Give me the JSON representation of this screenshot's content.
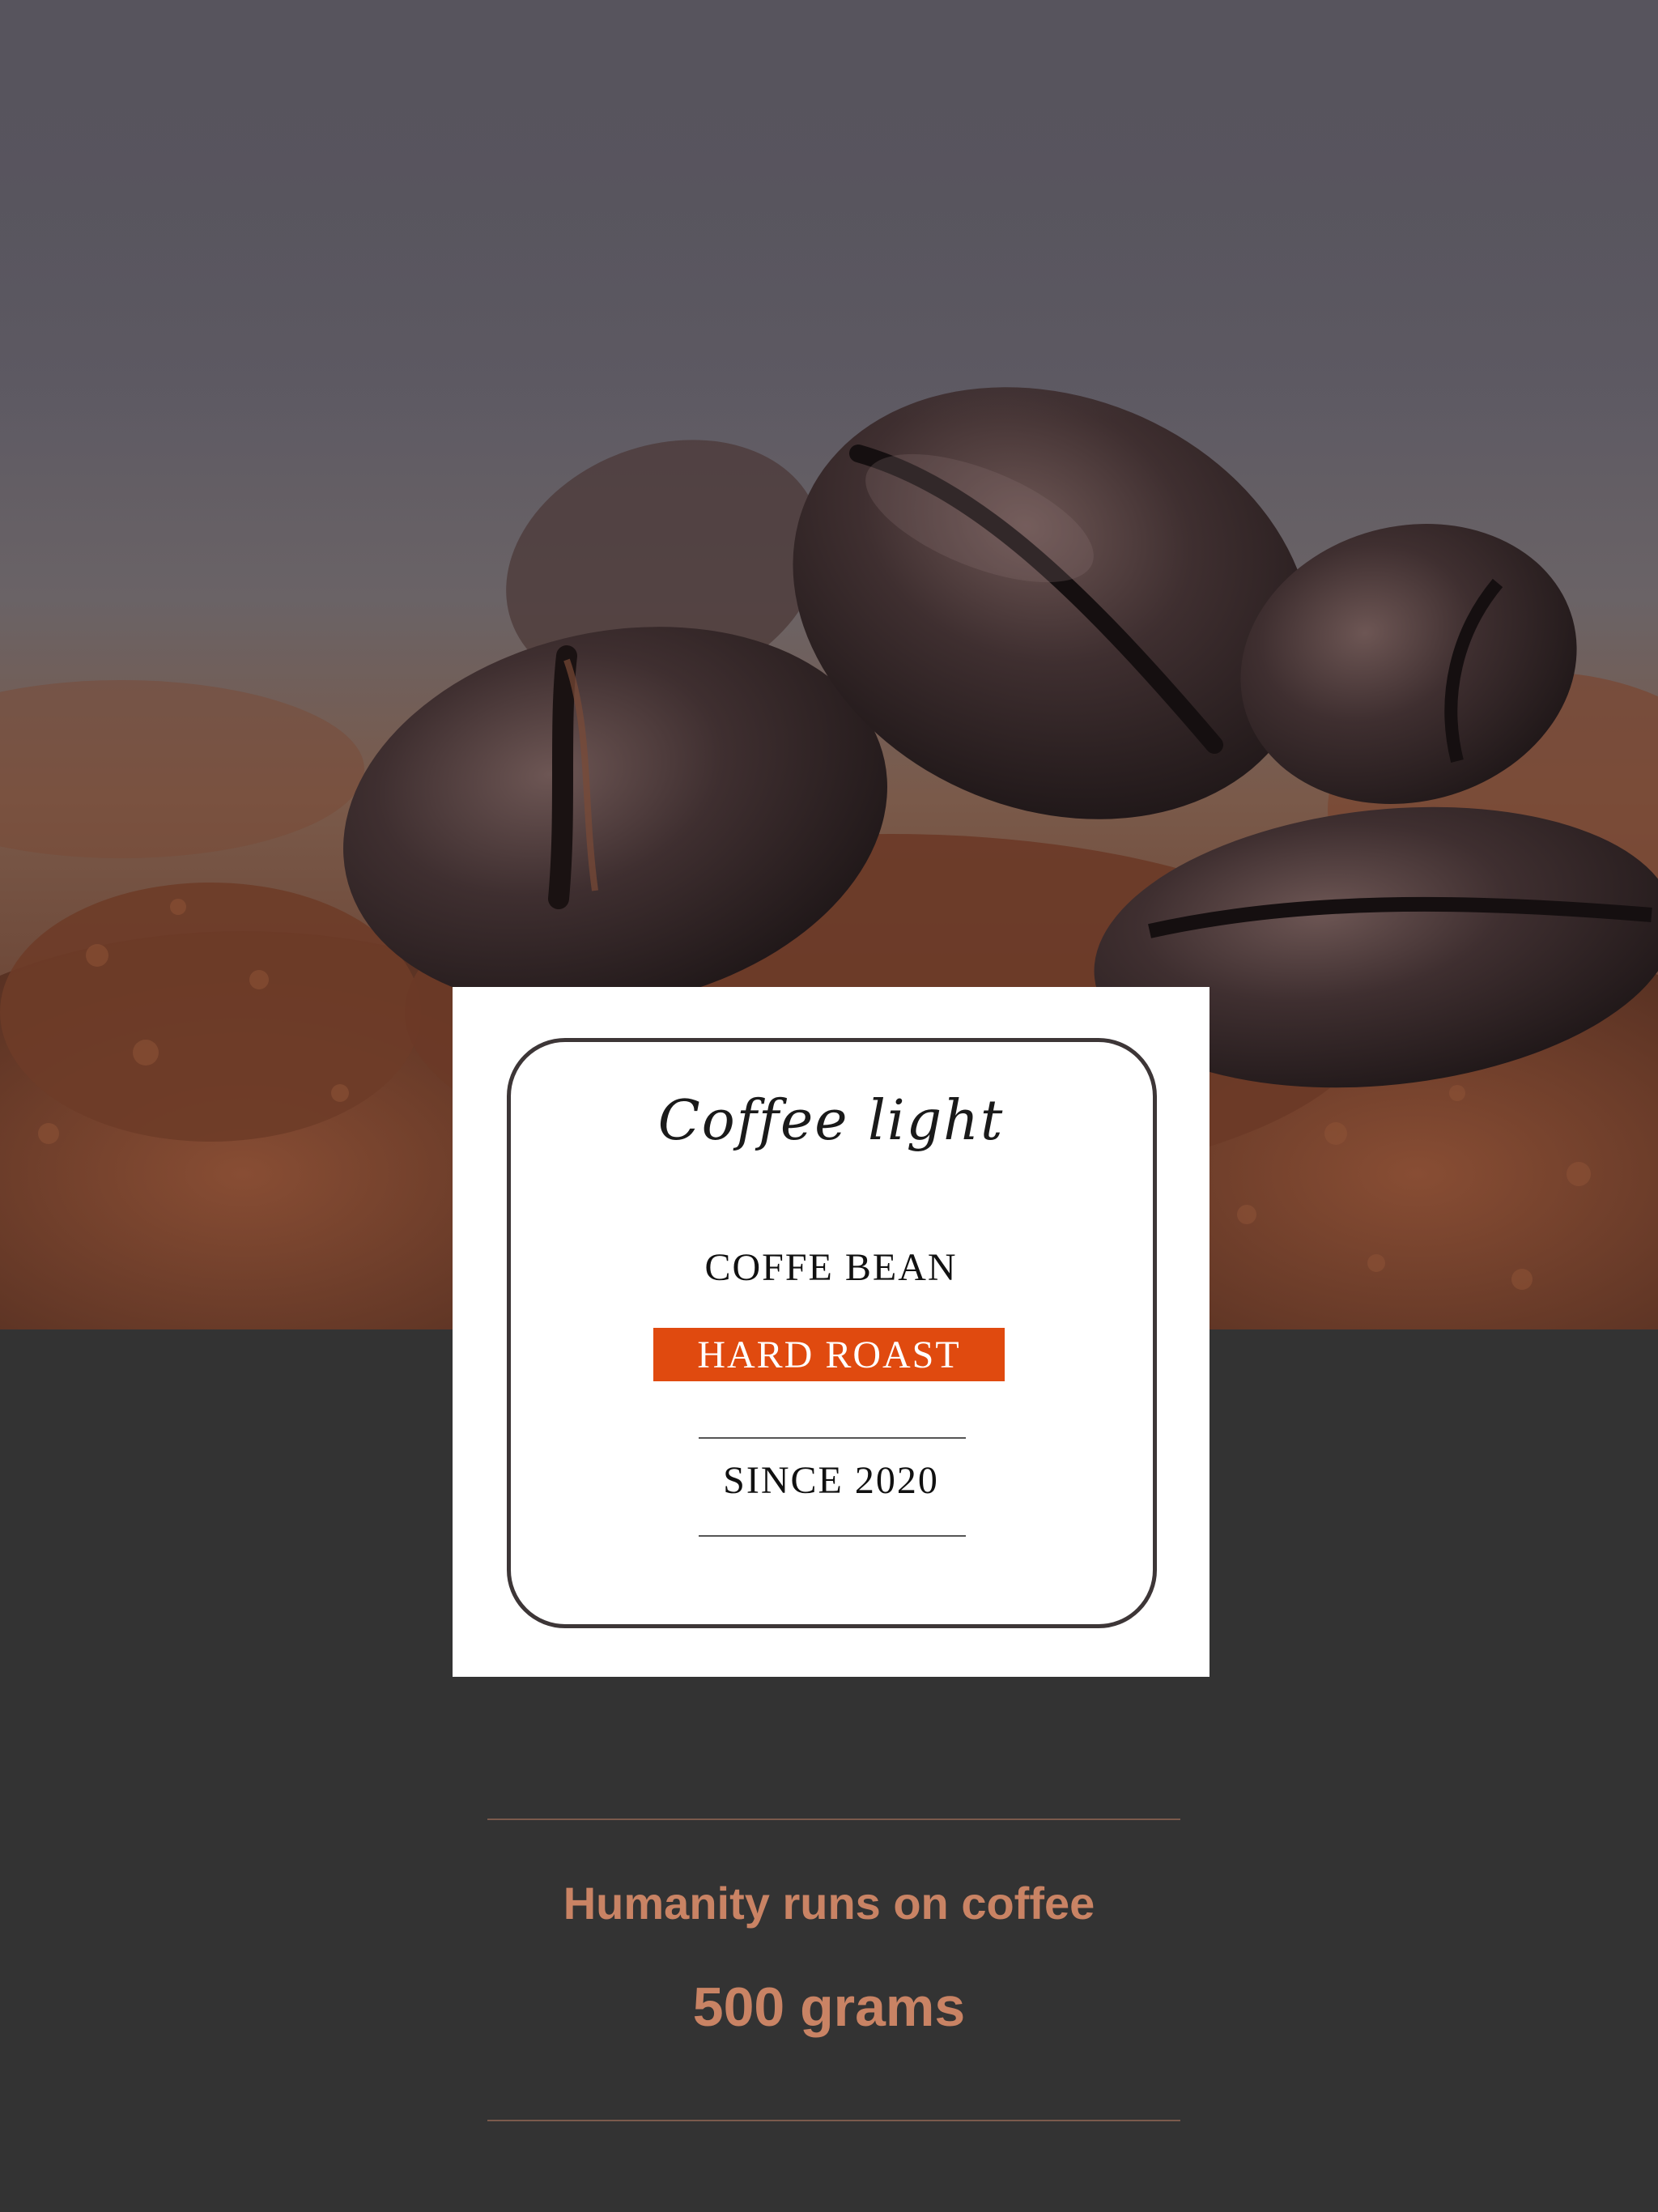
{
  "label": {
    "brand": "Coffee light",
    "product": "COFFE BEAN",
    "roast": "HARD ROAST",
    "since": "SINCE 2020"
  },
  "footer": {
    "tagline": "Humanity runs on coffee",
    "weight": "500 grams"
  },
  "colors": {
    "background": "#333333",
    "accent_orange": "#e04a0f",
    "footer_text": "#c98364",
    "label_white": "#ffffff"
  }
}
